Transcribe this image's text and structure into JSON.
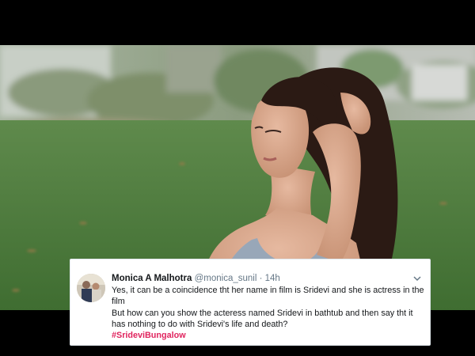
{
  "tweet": {
    "display_name": "Monica A Malhotra",
    "handle": "@monica_sunil",
    "separator": "·",
    "time": "14h",
    "line1": "Yes, it can be a coincidence tht her name in film is Sridevi and she is actress in the film",
    "line2": "But how can you show the acteress named Sridevi in bathtub and then say tht it has nothing to do with Sridevi's life and death?",
    "hashtag": "#SrideviBungalow",
    "hashtag_color": "#e0245e"
  },
  "icons": {
    "avatar": "profile-photo",
    "menu": "chevron-down-icon"
  }
}
